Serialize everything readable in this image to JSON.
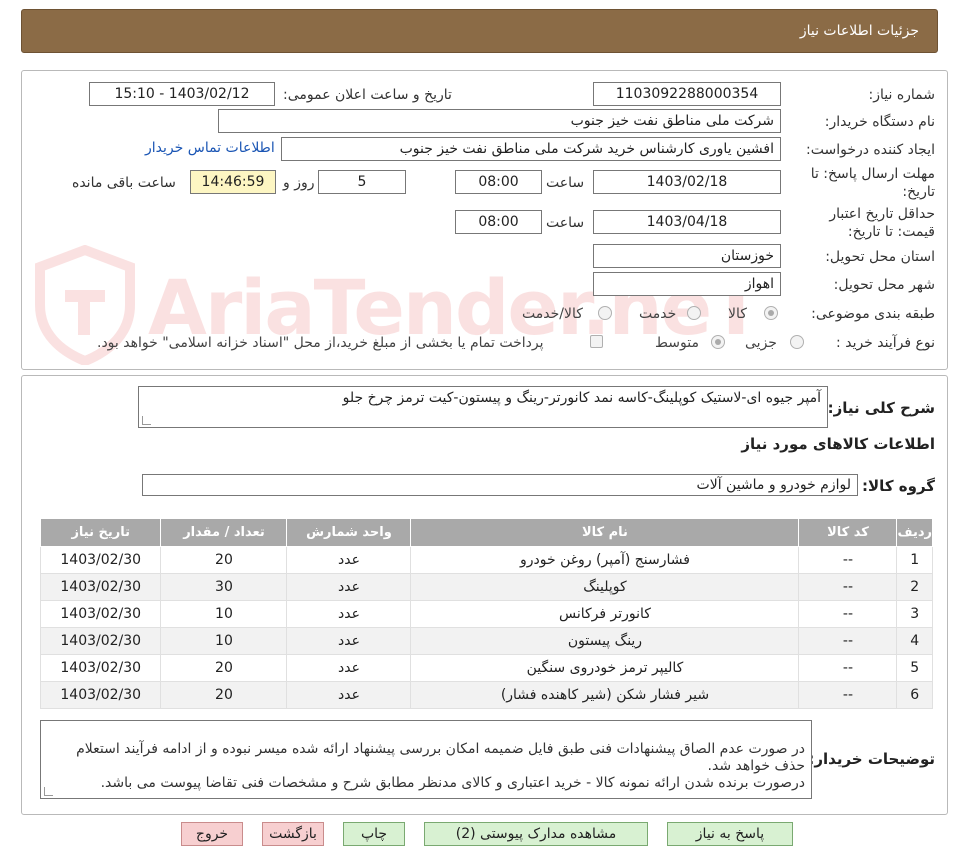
{
  "header": {
    "title": "جزئیات اطلاعات نیاز"
  },
  "form": {
    "need_number": {
      "label": "شماره نیاز:",
      "value": "1103092288000354"
    },
    "announce": {
      "label": "تاریخ و ساعت اعلان عمومی:",
      "value": "1403/02/12 - 15:10"
    },
    "buyer_org": {
      "label": "نام دستگاه خریدار:",
      "value": "شرکت ملی مناطق نفت خیز جنوب"
    },
    "requester": {
      "label": "ایجاد کننده درخواست:",
      "value": "افشین  یاوری  کارشناس خرید  شرکت ملی مناطق نفت خیز جنوب",
      "contact_link": "اطلاعات تماس خریدار"
    },
    "reply_deadline": {
      "label_line1": "مهلت ارسال پاسخ: تا",
      "label_line2": "تاریخ:",
      "date": "1403/02/18",
      "time_label": "ساعت",
      "time": "08:00",
      "days": "5",
      "days_label": "روز و",
      "remaining_time": "14:46:59",
      "remaining_label": "ساعت باقی مانده"
    },
    "validity": {
      "label_line1": "حداقل تاریخ اعتبار",
      "label_line2": "قیمت: تا تاریخ:",
      "date": "1403/04/18",
      "time_label": "ساعت",
      "time": "08:00"
    },
    "province": {
      "label": "استان محل تحویل:",
      "value": "خوزستان"
    },
    "city": {
      "label": "شهر محل تحویل:",
      "value": "اهواز"
    },
    "category": {
      "label": "طبقه بندی موضوعی:",
      "options": [
        "کالا",
        "خدمت",
        "کالا/خدمت"
      ],
      "selected": "کالا"
    },
    "process": {
      "label": "نوع فرآیند خرید :",
      "options": [
        "جزیی",
        "متوسط"
      ],
      "selected": "متوسط",
      "payment_note": "پرداخت تمام یا بخشی از مبلغ خرید،از محل \"اسناد خزانه اسلامی\" خواهد بود."
    }
  },
  "details": {
    "summary_label": "شرح کلی نیاز:",
    "summary": "آمپر جیوه ای-لاستیک کوپلینگ-کاسه نمد کانورتر-رینگ و پیستون-کیت ترمز چرخ جلو",
    "goods_title": "اطلاعات کالاهای مورد نیاز",
    "group_label": "گروه کالا:",
    "group": "لوازم خودرو و ماشین آلات"
  },
  "table": {
    "headers": [
      "ردیف",
      "کد کالا",
      "نام کالا",
      "واحد شمارش",
      "تعداد / مقدار",
      "تاریخ نیاز"
    ],
    "rows": [
      [
        "1",
        "--",
        "فشارسنج (آمپر) روغن خودرو",
        "عدد",
        "20",
        "1403/02/30"
      ],
      [
        "2",
        "--",
        "کوپلینگ",
        "عدد",
        "30",
        "1403/02/30"
      ],
      [
        "3",
        "--",
        "کانورتر فرکانس",
        "عدد",
        "10",
        "1403/02/30"
      ],
      [
        "4",
        "--",
        "رینگ پیستون",
        "عدد",
        "10",
        "1403/02/30"
      ],
      [
        "5",
        "--",
        "کالیپر ترمز خودروی سنگین",
        "عدد",
        "20",
        "1403/02/30"
      ],
      [
        "6",
        "--",
        "شیر فشار شکن (شیر کاهنده فشار)",
        "عدد",
        "20",
        "1403/02/30"
      ]
    ]
  },
  "notes": {
    "label": "توضیحات خریدار:",
    "text": "در صورت عدم الصاق پیشنهادات فنی طبق فایل ضمیمه امکان بررسی پیشنهاد ارائه شده میسر نبوده و از ادامه فرآیند استعلام حذف خواهد شد.\nدرصورت برنده شدن ارائه نمونه کالا - خرید اعتباری و کالای مدنظر مطابق شرح و مشخصات فنی تقاضا پیوست می باشد."
  },
  "buttons": {
    "reply": "پاسخ به نیاز",
    "attachments": "مشاهده مدارک پیوستی (2)",
    "print": "چاپ",
    "back": "بازگشت",
    "exit": "خروج"
  },
  "watermark": {
    "text": "AriaTender.neT"
  },
  "colors": {
    "header_bg": "#8b6b46",
    "table_header": "#a9a9a9",
    "link": "#1a55b4",
    "green_btn": "#d8f1d2",
    "red_btn": "#f7cfd0"
  }
}
